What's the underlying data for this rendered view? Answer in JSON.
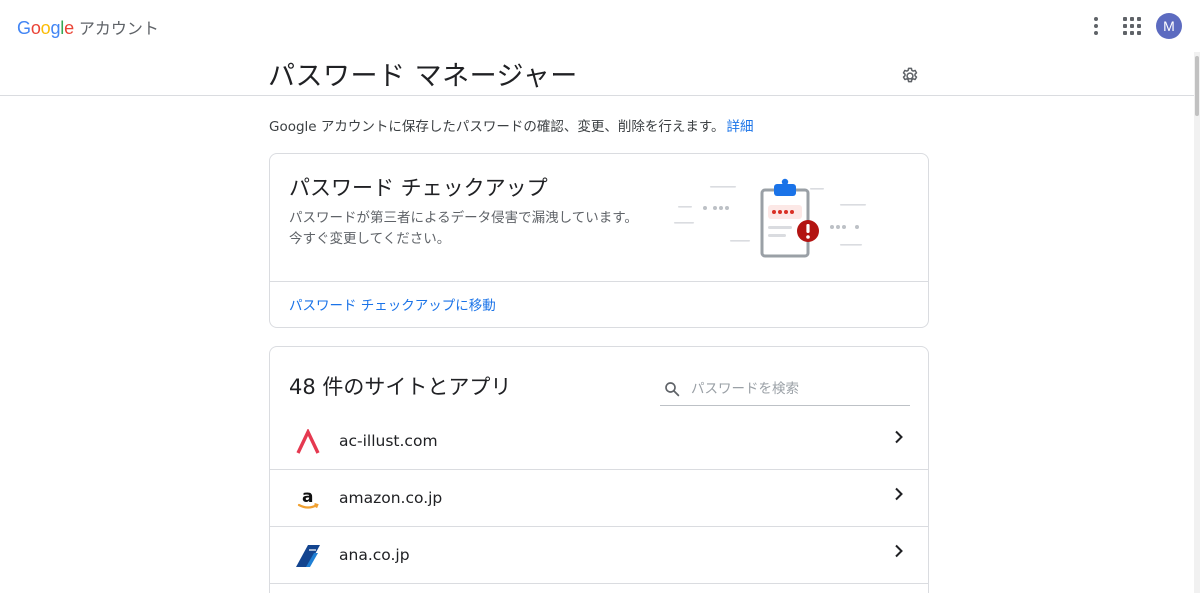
{
  "header": {
    "logo_letters": [
      "G",
      "o",
      "o",
      "g",
      "l",
      "e"
    ],
    "logo_colors": [
      "#4285F4",
      "#EA4335",
      "#FBBC05",
      "#4285F4",
      "#34A853",
      "#EA4335"
    ],
    "brand_suffix": "アカウント",
    "avatar_initial": "M",
    "avatar_color": "#5c6bc0"
  },
  "page": {
    "title": "パスワード マネージャー",
    "description": "Google アカウントに保存したパスワードの確認、変更、削除を行えます。",
    "description_link": "詳細"
  },
  "checkup": {
    "title": "パスワード チェックアップ",
    "desc_line1": "パスワードが第三者によるデータ侵害で漏洩しています。",
    "desc_line2": "今すぐ変更してください。",
    "link": "パスワード チェックアップに移動"
  },
  "passwords": {
    "count_title": "48 件のサイトとアプリ",
    "search_placeholder": "パスワードを検索",
    "sites": [
      {
        "name": "ac-illust.com",
        "icon": "ac-illust-icon"
      },
      {
        "name": "amazon.co.jp",
        "icon": "amazon-icon"
      },
      {
        "name": "ana.co.jp",
        "icon": "ana-icon"
      }
    ]
  },
  "colors": {
    "accent": "#1a73e8",
    "warning": "#d93025",
    "divider": "#dadce0"
  }
}
